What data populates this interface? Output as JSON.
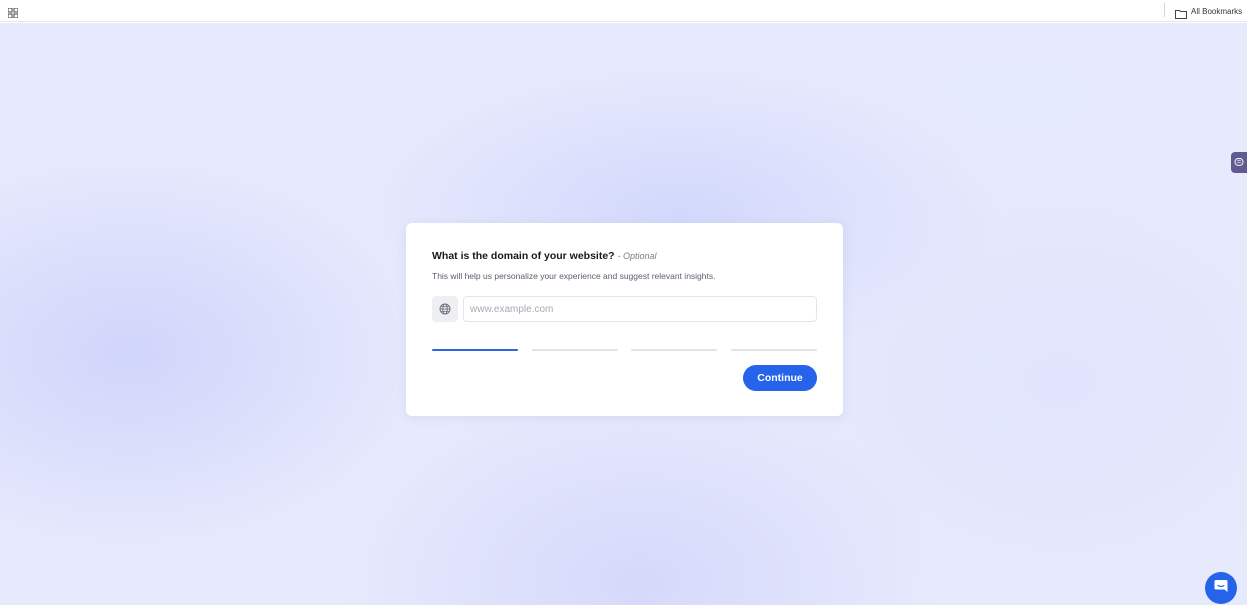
{
  "bookmarks_bar": {
    "apps_icon": "apps-grid-icon",
    "folder_icon": "folder-icon",
    "folder_label": "All Bookmarks"
  },
  "card": {
    "title": "What is the domain of your website?",
    "optional_tag": "- Optional",
    "subtitle": "This will help us personalize your experience and suggest relevant insights.",
    "input_icon": "globe-icon",
    "input_value": "",
    "input_placeholder": "www.example.com",
    "progress": {
      "total_steps": 4,
      "current_step": 1
    },
    "continue_label": "Continue"
  },
  "side_tab_icon": "brain-icon",
  "chat_icon": "chat-bubble-icon",
  "colors": {
    "accent": "#2563eb",
    "progress_active": "#2e65d8",
    "progress_inactive": "#e3e4e8",
    "background": "#e7e9fc",
    "side_tab": "#5f5a92"
  }
}
